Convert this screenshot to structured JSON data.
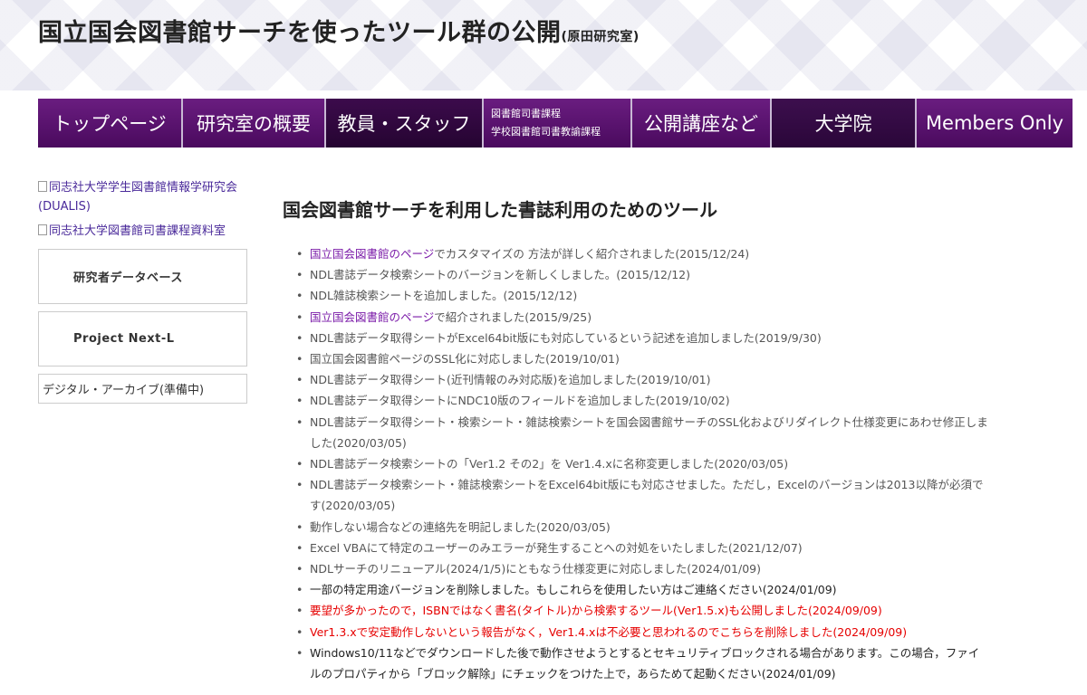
{
  "header": {
    "title": "国立国会図書館サーチを使ったツール群の公開",
    "subtitle": "(原田研究室)"
  },
  "nav": {
    "items": [
      {
        "label": "トップページ"
      },
      {
        "label": "研究室の概要"
      },
      {
        "label": "教員・スタッフ"
      },
      {
        "line1": "図書館司書課程",
        "line2": "学校図書館司書教諭課程"
      },
      {
        "label": "公開講座など"
      },
      {
        "label": "大学院"
      },
      {
        "label": "Members Only"
      }
    ]
  },
  "sidebar": {
    "links": [
      {
        "label": "同志社大学学生図書館情報学研究会(DUALIS)"
      },
      {
        "label": "同志社大学図書館司書課程資料室"
      }
    ],
    "boxes": [
      {
        "label": "研究者データベース"
      },
      {
        "label": "Project Next-L"
      },
      {
        "label": "デジタル・アーカイブ(準備中)"
      }
    ]
  },
  "main": {
    "heading": "国会図書館サーチを利用した書誌利用のためのツール",
    "news": [
      {
        "link": "国立国会図書館のページ",
        "text": "でカスタマイズの 方法が詳しく紹介されました(2015/12/24)"
      },
      {
        "text": "NDL書誌データ検索シートのバージョンを新しくしました。(2015/12/12)"
      },
      {
        "text": "NDL雑誌検索シートを追加しました。(2015/12/12)"
      },
      {
        "link": "国立国会図書館のページ",
        "text": "で紹介されました(2015/9/25)"
      },
      {
        "text": "NDL書誌データ取得シートがExcel64bit版にも対応しているという記述を追加しました(2019/9/30)"
      },
      {
        "text": "国立国会図書館ページのSSL化に対応しました(2019/10/01)"
      },
      {
        "text": "NDL書誌データ取得シート(近刊情報のみ対応版)を追加しました(2019/10/01)"
      },
      {
        "text": "NDL書誌データ取得シートにNDC10版のフィールドを追加しました(2019/10/02)"
      },
      {
        "text": "NDL書誌データ取得シート・検索シート・雑誌検索シートを国会図書館サーチのSSL化およびリダイレクト仕様変更にあわせ修正しました(2020/03/05)"
      },
      {
        "text": "NDL書誌データ検索シートの「Ver1.2 その2」を Ver1.4.xに名称変更しました(2020/03/05)"
      },
      {
        "text": "NDL書誌データ検索シート・雑誌検索シートをExcel64bit版にも対応させました。ただし，Excelのバージョンは2013以降が必須です(2020/03/05)"
      },
      {
        "text": "動作しない場合などの連絡先を明記しました(2020/03/05)"
      },
      {
        "text": "Excel VBAにて特定のユーザーのみエラーが発生することへの対処をいたしました(2021/12/07)"
      },
      {
        "text": "NDLサーチのリニューアル(2024/1/5)にともなう仕様変更に対応しました(2024/01/09)"
      },
      {
        "text": "一部の特定用途バージョンを削除しました。もしこれらを使用したい方はご連絡ください(2024/01/09)"
      },
      {
        "text": "要望が多かったので，ISBNではなく書名(タイトル)から検索するツール(Ver1.5.x)も公開しました(2024/09/09)"
      },
      {
        "text": "Ver1.3.xで安定動作しないという報告がなく，Ver1.4.xは不必要と思われるのでこちらを削除しました(2024/09/09)"
      },
      {
        "text": "Windows10/11などでダウンロードした後で動作させようとするとセキュリティブロックされる場合があります。この場合，ファイルのプロパティから「ブロック解除」にチェックをつけた上で，あらためて起動ください(2024/01/09)"
      }
    ]
  },
  "colors": {
    "nav_bg": "#5a1470",
    "link": "#7a1aa8",
    "alert": "#e60000"
  }
}
